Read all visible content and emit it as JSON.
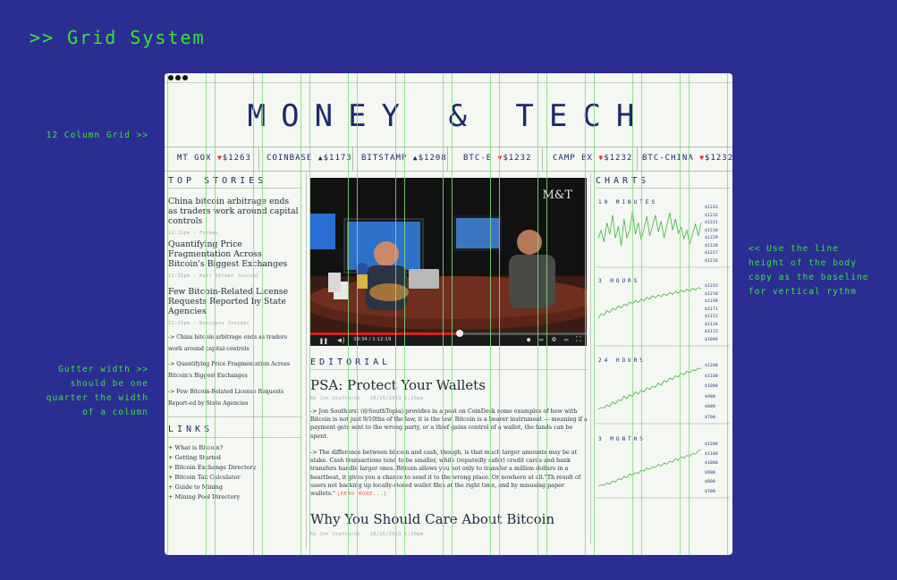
{
  "page": {
    "heading": ">> Grid System",
    "annotations": {
      "column_grid": "12 Column Grid >>",
      "gutter_line1": "Gutter width >>",
      "gutter_line2": "should be one",
      "gutter_line3": "quarter the width",
      "gutter_line4": "of a column",
      "baseline_line1": "<< Use the line",
      "baseline_line2": "height of the body",
      "baseline_line3": "copy as the baseline",
      "baseline_line4": "for vertical rythm"
    }
  },
  "site": {
    "logo": "MONEY & TECH",
    "ticker": [
      {
        "name": "MT GOX",
        "dir": "down",
        "price": "$1263"
      },
      {
        "name": "COINBASE",
        "dir": "up",
        "price": "$1173"
      },
      {
        "name": "BITSTAMP",
        "dir": "up",
        "price": "$1208"
      },
      {
        "name": "BTC-E",
        "dir": "down",
        "price": "$1232"
      },
      {
        "name": "CAMP BX",
        "dir": "down",
        "price": "$1232"
      },
      {
        "name": "BTC-CHINA",
        "dir": "down",
        "price": "$1232"
      }
    ],
    "top_stories": {
      "label": "TOP STORIES",
      "items": [
        {
          "title": "China bitcoin arbitrage ends as traders work around capital controls",
          "meta": "12:15pm - Forbes"
        },
        {
          "title": "Quantifying Price Fragmentation Across Bitcoin's Biggest Exchanges",
          "meta": "12:15pm - Wall Street Journal"
        },
        {
          "title": "Few Bitcoin-Related License Requests Reported by State Agencies",
          "meta": "12:15pm - Business Insider"
        }
      ],
      "small": [
        "-> China bitcoin arbitrage ends as traders work around capital controls",
        "-> Quantifying Price Fragmentation Across Bitcoin's Biggest Exchanges",
        "-> Few Bitcoin-Related License Requests Report-ed by State Agencies"
      ]
    },
    "links": {
      "label": "LINKS",
      "items": [
        "+ What is Bitcoin?",
        "+ Getting Started",
        "+ Bitcoin Exchange Directory",
        "+ Bitcoin Tax Calculator",
        "+ Guide to Mining",
        "+ Mining Pool Directory"
      ]
    },
    "video": {
      "watermark": "M&T",
      "time": "39:34 / 1:12:19",
      "progress": 0.54
    },
    "editorial": {
      "label": "EDITORIAL",
      "article1": {
        "title": "PSA: Protect Your Wallets",
        "meta": "By Jon Southurst - 10/15/2013 1:20pm",
        "p1": "-> Jon Southurst (@SouthTopia) provides in a post on CoinDesk some examples of how with Bitcoin is not just 9/10ths of the law, it is the law.  Bitcoin is a bearer instrument — meaning if a payment gets sent to the wrong party, or a thief gains control of a wallet, the funds can be spent.",
        "p2": "-> The difference between bitcoin and cash, though, is that much larger amounts may be at stake. Cash transactions tend to be smaller, while (reputedly safer) credit cards and bank transfers handle larger ones. Bitcoin allows you not only to transfer a million dollars in a heartbeat, it gives you a chance to send it to the wrong place. Or nowhere at all.\"Th result of users not backing up locally-stored wallet files at the right time, and by misusing paper wallets.\"",
        "readmore": "[READ MORE...]"
      },
      "article2": {
        "title": "Why You Should Care About Bitcoin",
        "meta": "By Jon Southurst - 10/15/2013 1:20pm"
      }
    },
    "charts": {
      "label": "CHARTS",
      "panels": [
        {
          "label": "10 MINUTES",
          "ticks": [
            "$1233",
            "$1232",
            "$1231",
            "$1230",
            "$1229",
            "$1228",
            "$1227",
            "$1226"
          ]
        },
        {
          "label": "3 HOURS",
          "ticks": [
            "$1233",
            "$1210",
            "$1190",
            "$1171",
            "$1152",
            "$1134",
            "$1115",
            "$1096"
          ]
        },
        {
          "label": "24 HOURS",
          "ticks": [
            "$1200",
            "$1100",
            "$1000",
            "$900",
            "$800",
            "$700"
          ]
        },
        {
          "label": "3 MONTHS",
          "ticks": [
            "$1200",
            "$1100",
            "$1000",
            "$900",
            "$800",
            "$700"
          ]
        }
      ]
    },
    "chart_data": [
      {
        "type": "line",
        "title": "10 MINUTES",
        "ylim": [
          1226,
          1233
        ],
        "values": [
          1229,
          1230,
          1228.5,
          1231,
          1229.5,
          1232,
          1229,
          1230.5,
          1228,
          1231.5,
          1229,
          1230,
          1232.5,
          1229.5,
          1231,
          1228.8,
          1230.2,
          1231.8,
          1229.3,
          1230.6,
          1232,
          1229.8,
          1231.2,
          1229,
          1230.7,
          1232.3,
          1230,
          1231.5,
          1229.6,
          1230.4,
          1228.9,
          1230,
          1228.2,
          1229.5,
          1230.8,
          1229.3,
          1231
        ]
      },
      {
        "type": "line",
        "title": "3 HOURS",
        "ylim": [
          1096,
          1233
        ],
        "values": [
          1150,
          1162,
          1158,
          1170,
          1165,
          1176,
          1172,
          1182,
          1177,
          1186,
          1183,
          1192,
          1187,
          1196,
          1191,
          1200,
          1195,
          1204,
          1199,
          1208,
          1203,
          1210,
          1206,
          1213,
          1209,
          1216,
          1212,
          1219,
          1215,
          1222,
          1218,
          1225,
          1220,
          1227,
          1223,
          1229,
          1226
        ]
      },
      {
        "type": "line",
        "title": "24 HOURS",
        "ylim": [
          700,
          1200
        ],
        "values": [
          780,
          795,
          790,
          820,
          805,
          850,
          830,
          870,
          860,
          905,
          880,
          920,
          900,
          945,
          925,
          960,
          945,
          985,
          970,
          1000,
          990,
          1030,
          1010,
          1055,
          1040,
          1080,
          1065,
          1100,
          1090,
          1125,
          1110,
          1145,
          1130,
          1160,
          1150,
          1175,
          1170
        ]
      },
      {
        "type": "line",
        "title": "3 MONTHS",
        "ylim": [
          700,
          1200
        ],
        "values": [
          760,
          770,
          765,
          790,
          780,
          810,
          800,
          835,
          825,
          860,
          845,
          885,
          870,
          900,
          890,
          925,
          915,
          945,
          935,
          960,
          955,
          985,
          970,
          1000,
          990,
          1020,
          1010,
          1045,
          1030,
          1065,
          1055,
          1080,
          1075,
          1100,
          1095,
          1130,
          1145
        ]
      }
    ]
  }
}
